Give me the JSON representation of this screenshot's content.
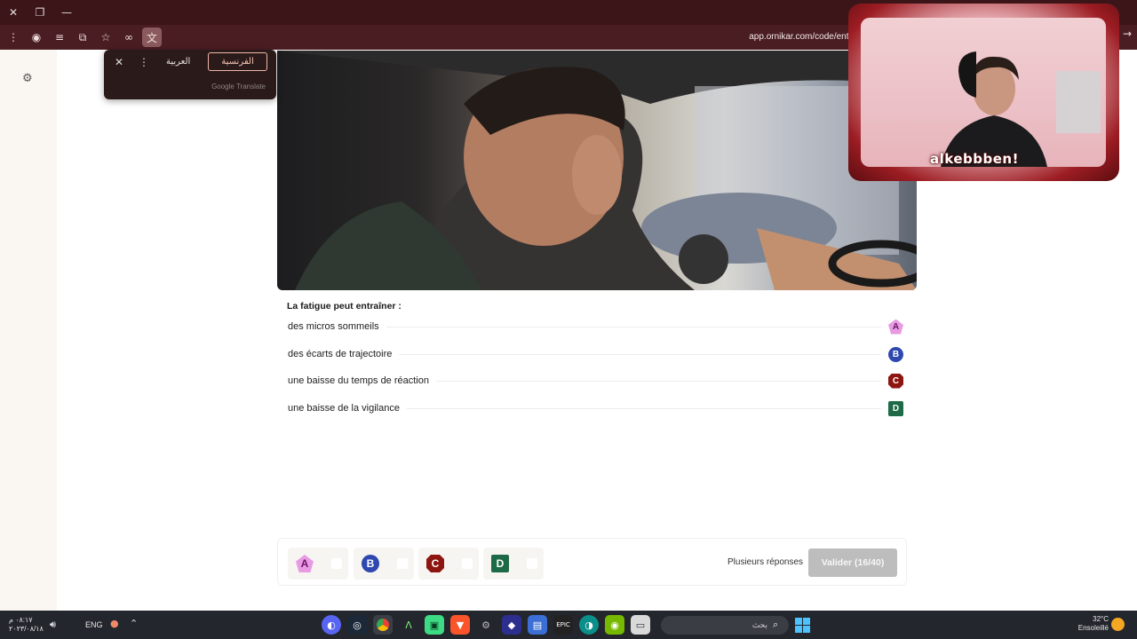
{
  "browser": {
    "url": "app.ornikar.com/code/entrainement",
    "translate_popup": {
      "language_ar": "العربية",
      "language_fr": "الفرنسية",
      "brand": "Google Translate"
    }
  },
  "quiz": {
    "question": "La fatigue peut entraîner :",
    "answers": [
      {
        "letter": "A",
        "text": "des micros sommeils",
        "color": "#e89be3"
      },
      {
        "letter": "B",
        "text": "des écarts de trajectoire",
        "color": "#2f48b0"
      },
      {
        "letter": "C",
        "text": "une baisse du temps de réaction",
        "color": "#8e1610"
      },
      {
        "letter": "D",
        "text": "une baisse de la vigilance",
        "color": "#1e6a47"
      }
    ],
    "multiple_label": "Plusieurs réponses",
    "validate_label": "Valider (16/40)"
  },
  "webcam": {
    "name": "alkebbben!"
  },
  "taskbar": {
    "time": "٠٨:١٧ م",
    "date": "٢٠٢٣/٠٨/١٨",
    "language": "ENG",
    "search_placeholder": "بحث",
    "weather_temp": "32°C",
    "weather_desc": "Ensoleillé"
  },
  "icons": {
    "settings": "gear-icon",
    "close": "close-icon",
    "more": "more-vertical-icon",
    "star": "star-icon",
    "extensions": "puzzle-icon",
    "translate": "translate-icon"
  }
}
